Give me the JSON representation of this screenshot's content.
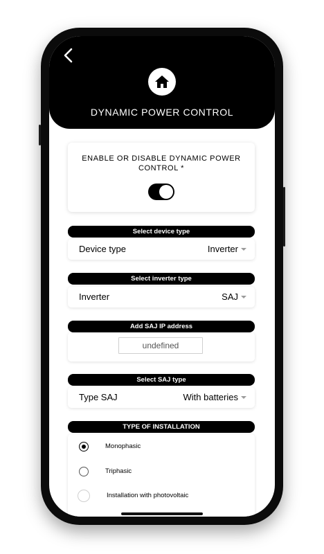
{
  "header": {
    "title": "DYNAMIC POWER CONTROL",
    "back_icon": "chevron-left-icon",
    "home_icon": "home-icon"
  },
  "enable_card": {
    "title": "ENABLE OR DISABLE DYNAMIC POWER CONTROL *",
    "toggle_on": true
  },
  "device_section": {
    "header": "Select device type",
    "label": "Device type",
    "value": "Inverter"
  },
  "inverter_section": {
    "header": "Select inverter type",
    "label": "Inverter",
    "value": "SAJ"
  },
  "ip_section": {
    "header": "Add SAJ IP address",
    "value": "undefined"
  },
  "saj_section": {
    "header": "Select SAJ type",
    "label": "Type SAJ",
    "value": "With batteries"
  },
  "installation_section": {
    "header": "TYPE OF INSTALLATION",
    "options": [
      {
        "label": "Monophasic",
        "selected": true
      },
      {
        "label": "Triphasic",
        "selected": false
      },
      {
        "label": "Installation with photovoltaic",
        "selected": false
      }
    ]
  },
  "colors": {
    "primary": "#000000",
    "background": "#ffffff",
    "caret": "#9b9b9b"
  }
}
